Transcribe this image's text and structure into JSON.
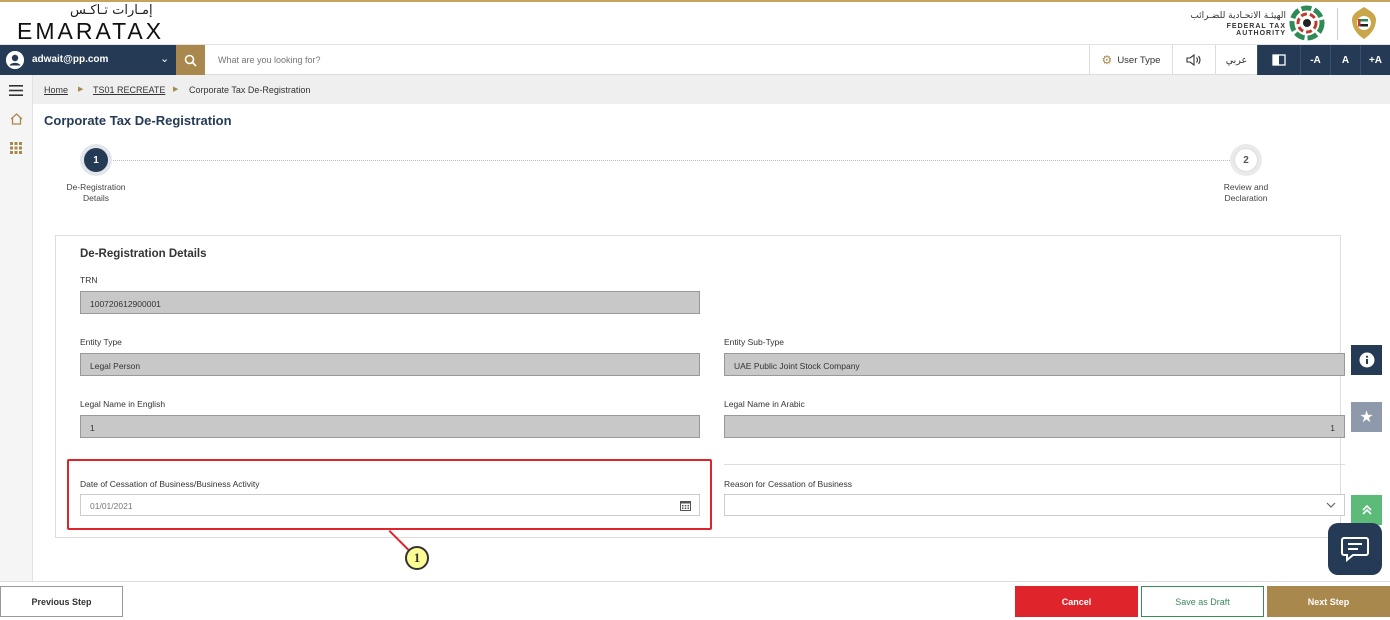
{
  "header": {
    "logo_arabic": "إمـارات تـاكـس",
    "logo_text": "EMARATAX",
    "authority_arabic": "الهيئـة الاتحـادية للضـرائب",
    "authority_english": "FEDERAL TAX AUTHORITY"
  },
  "toolbar": {
    "user_email": "adwait@pp.com",
    "search_placeholder": "What are you looking for?",
    "user_type_label": "User Type",
    "arabic_label": "عربي",
    "font_decrease": "-A",
    "font_normal": "A",
    "font_increase": "+A"
  },
  "breadcrumb": [
    "Home",
    "TS01 RECREATE",
    "Corporate Tax De-Registration"
  ],
  "page_title": "Corporate Tax De-Registration",
  "steps": [
    {
      "number": "1",
      "label_line1": "De-Registration",
      "label_line2": "Details"
    },
    {
      "number": "2",
      "label_line1": "Review and",
      "label_line2": "Declaration"
    }
  ],
  "form": {
    "section_title": "De-Registration Details",
    "trn_label": "TRN",
    "trn_value": "100720612900001",
    "entity_type_label": "Entity Type",
    "entity_type_value": "Legal Person",
    "entity_subtype_label": "Entity Sub-Type",
    "entity_subtype_value": "UAE Public Joint Stock Company",
    "legal_name_en_label": "Legal Name in English",
    "legal_name_en_value": "1",
    "legal_name_ar_label": "Legal Name in Arabic",
    "legal_name_ar_value": "1",
    "cessation_date_label": "Date of Cessation of Business/Business Activity",
    "cessation_date_value": "01/01/2021",
    "cessation_reason_label": "Reason for Cessation of Business",
    "cessation_reason_value": ""
  },
  "annotation_marker": "1",
  "footer": {
    "previous_label": "Previous Step",
    "cancel_label": "Cancel",
    "save_draft_label": "Save as Draft",
    "next_label": "Next Step"
  },
  "colors": {
    "navy": "#253a55",
    "gold": "#a9884d",
    "cancel_red": "#e0242c",
    "save_green_text": "#3b8a5a"
  }
}
